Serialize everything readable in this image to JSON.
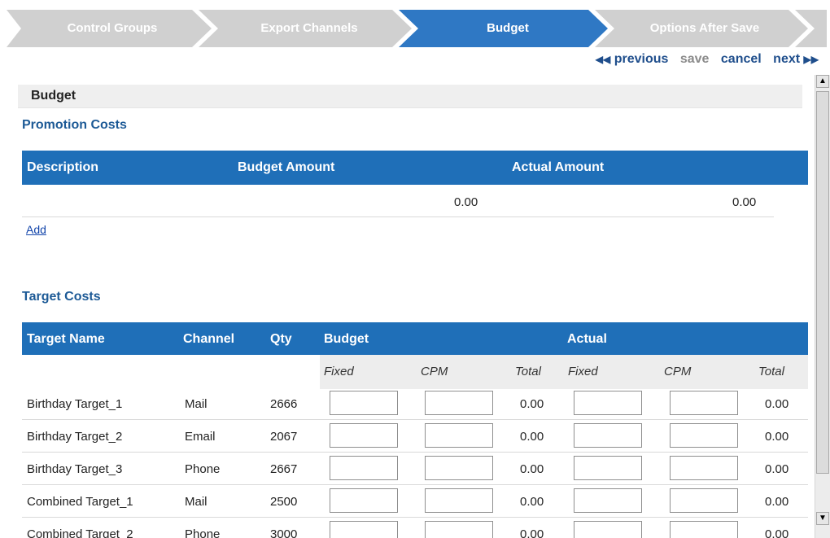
{
  "wizard": {
    "steps": [
      {
        "label": "Control Groups"
      },
      {
        "label": "Export Channels"
      },
      {
        "label": "Budget"
      },
      {
        "label": "Options After Save"
      }
    ],
    "colors": {
      "inactive": "#d0d0d0",
      "active": "#2f78c4"
    }
  },
  "nav": {
    "previous": "previous",
    "save": "save",
    "cancel": "cancel",
    "next": "next",
    "prev_icon": "◀◀",
    "next_icon": "▶▶"
  },
  "budget_section": {
    "title": "Budget",
    "promotion_costs": {
      "title": "Promotion Costs",
      "columns": [
        "Description",
        "Budget Amount",
        "Actual Amount"
      ],
      "rows": [
        {
          "description": "",
          "budget_amount": "0.00",
          "actual_amount": "0.00"
        }
      ],
      "add_label": "Add"
    },
    "target_costs": {
      "title": "Target Costs",
      "columns": [
        "Target Name",
        "Channel",
        "Qty",
        "Budget",
        "Actual"
      ],
      "subcolumns": [
        "Fixed",
        "CPM",
        "Total",
        "Fixed",
        "CPM",
        "Total"
      ],
      "rows": [
        {
          "name": "Birthday Target_1",
          "channel": "Mail",
          "qty": "2666",
          "budget_total": "0.00",
          "actual_total": "0.00"
        },
        {
          "name": "Birthday Target_2",
          "channel": "Email",
          "qty": "2067",
          "budget_total": "0.00",
          "actual_total": "0.00"
        },
        {
          "name": "Birthday Target_3",
          "channel": "Phone",
          "qty": "2667",
          "budget_total": "0.00",
          "actual_total": "0.00"
        },
        {
          "name": "Combined Target_1",
          "channel": "Mail",
          "qty": "2500",
          "budget_total": "0.00",
          "actual_total": "0.00"
        },
        {
          "name": "Combined Target_2",
          "channel": "Phone",
          "qty": "3000",
          "budget_total": "0.00",
          "actual_total": "0.00"
        }
      ]
    }
  },
  "colors": {
    "header_blue": "#1f6fb8",
    "title_blue": "#1d5a96"
  }
}
